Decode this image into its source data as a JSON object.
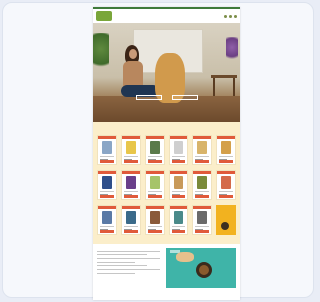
{
  "colors": {
    "brand_green": "#3f7a3a",
    "logo_green": "#7aa63a",
    "products_bg": "#fbeeca",
    "badge_red": "#e05a3a",
    "promo_yellow": "#f2b21f",
    "teal": "#3fb4a8"
  },
  "nav": {
    "logo": "",
    "links": [
      "",
      "",
      "",
      "",
      "",
      ""
    ]
  },
  "hero": {
    "title": "",
    "button_primary": "",
    "button_secondary": ""
  },
  "products": {
    "title": "",
    "link": "",
    "pack_colors": [
      "#8aa6c6",
      "#e8c64a",
      "#5a7a4a",
      "#cfcfcf",
      "#d8b46a",
      "#d4a04a",
      "#2f4f8a",
      "#6a3f8a",
      "#a6c46a",
      "#c89a5a",
      "#7a8a3a",
      "#d46a4a",
      "#5a7aa6",
      "#3a6a8a",
      "#8a5a3a",
      "#4a8a8a",
      "#6a6a6a"
    ]
  },
  "bottom": {
    "title": ""
  }
}
